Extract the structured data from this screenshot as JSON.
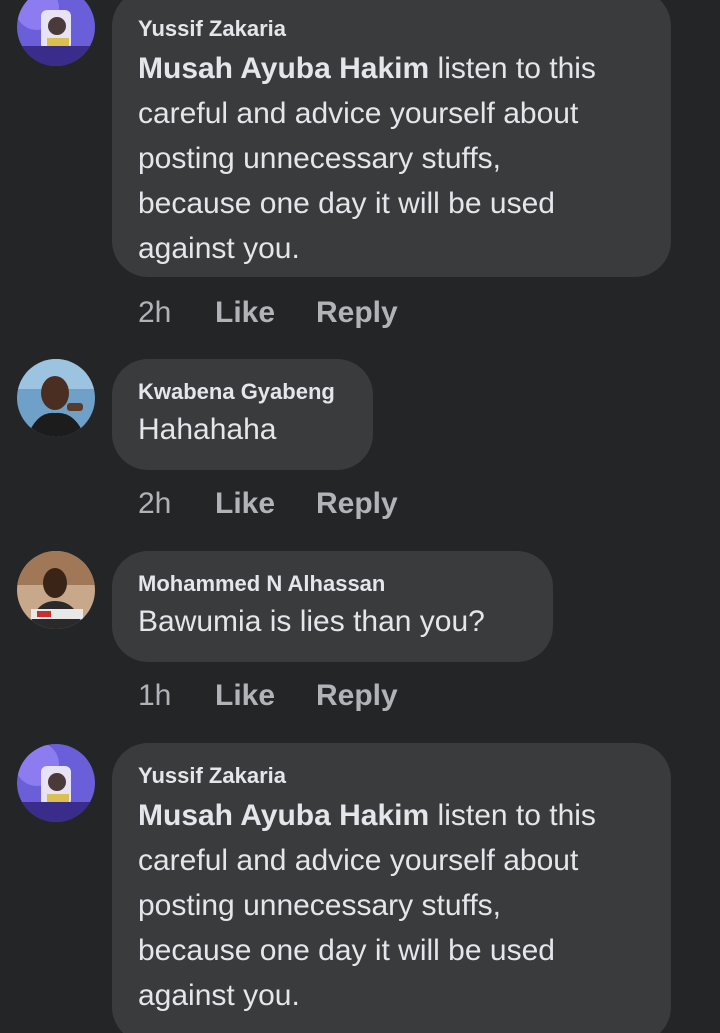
{
  "comments": [
    {
      "author": "Yussif Zakaria",
      "mention": "Musah Ayuba Hakim",
      "text_lines": [
        " listen to this",
        "careful and advice yourself about",
        "posting unnecessary stuffs,",
        "because one day it will be used",
        "against you."
      ],
      "time": "2h",
      "like_label": "Like",
      "reply_label": "Reply"
    },
    {
      "author": "Kwabena Gyabeng",
      "text": "Hahahaha",
      "time": "2h",
      "like_label": "Like",
      "reply_label": "Reply"
    },
    {
      "author": "Mohammed N Alhassan",
      "text": "Bawumia is lies than you?",
      "time": "1h",
      "like_label": "Like",
      "reply_label": "Reply"
    },
    {
      "author": "Yussif Zakaria",
      "mention": "Musah Ayuba Hakim",
      "text_lines": [
        " listen to this",
        "careful and advice yourself about",
        "posting unnecessary stuffs,",
        "because one day it will be used",
        "against you."
      ]
    }
  ],
  "colors": {
    "background": "#242526",
    "bubble": "#3a3b3c",
    "text_primary": "#e4e6eb",
    "text_secondary": "#b0b3b8"
  }
}
